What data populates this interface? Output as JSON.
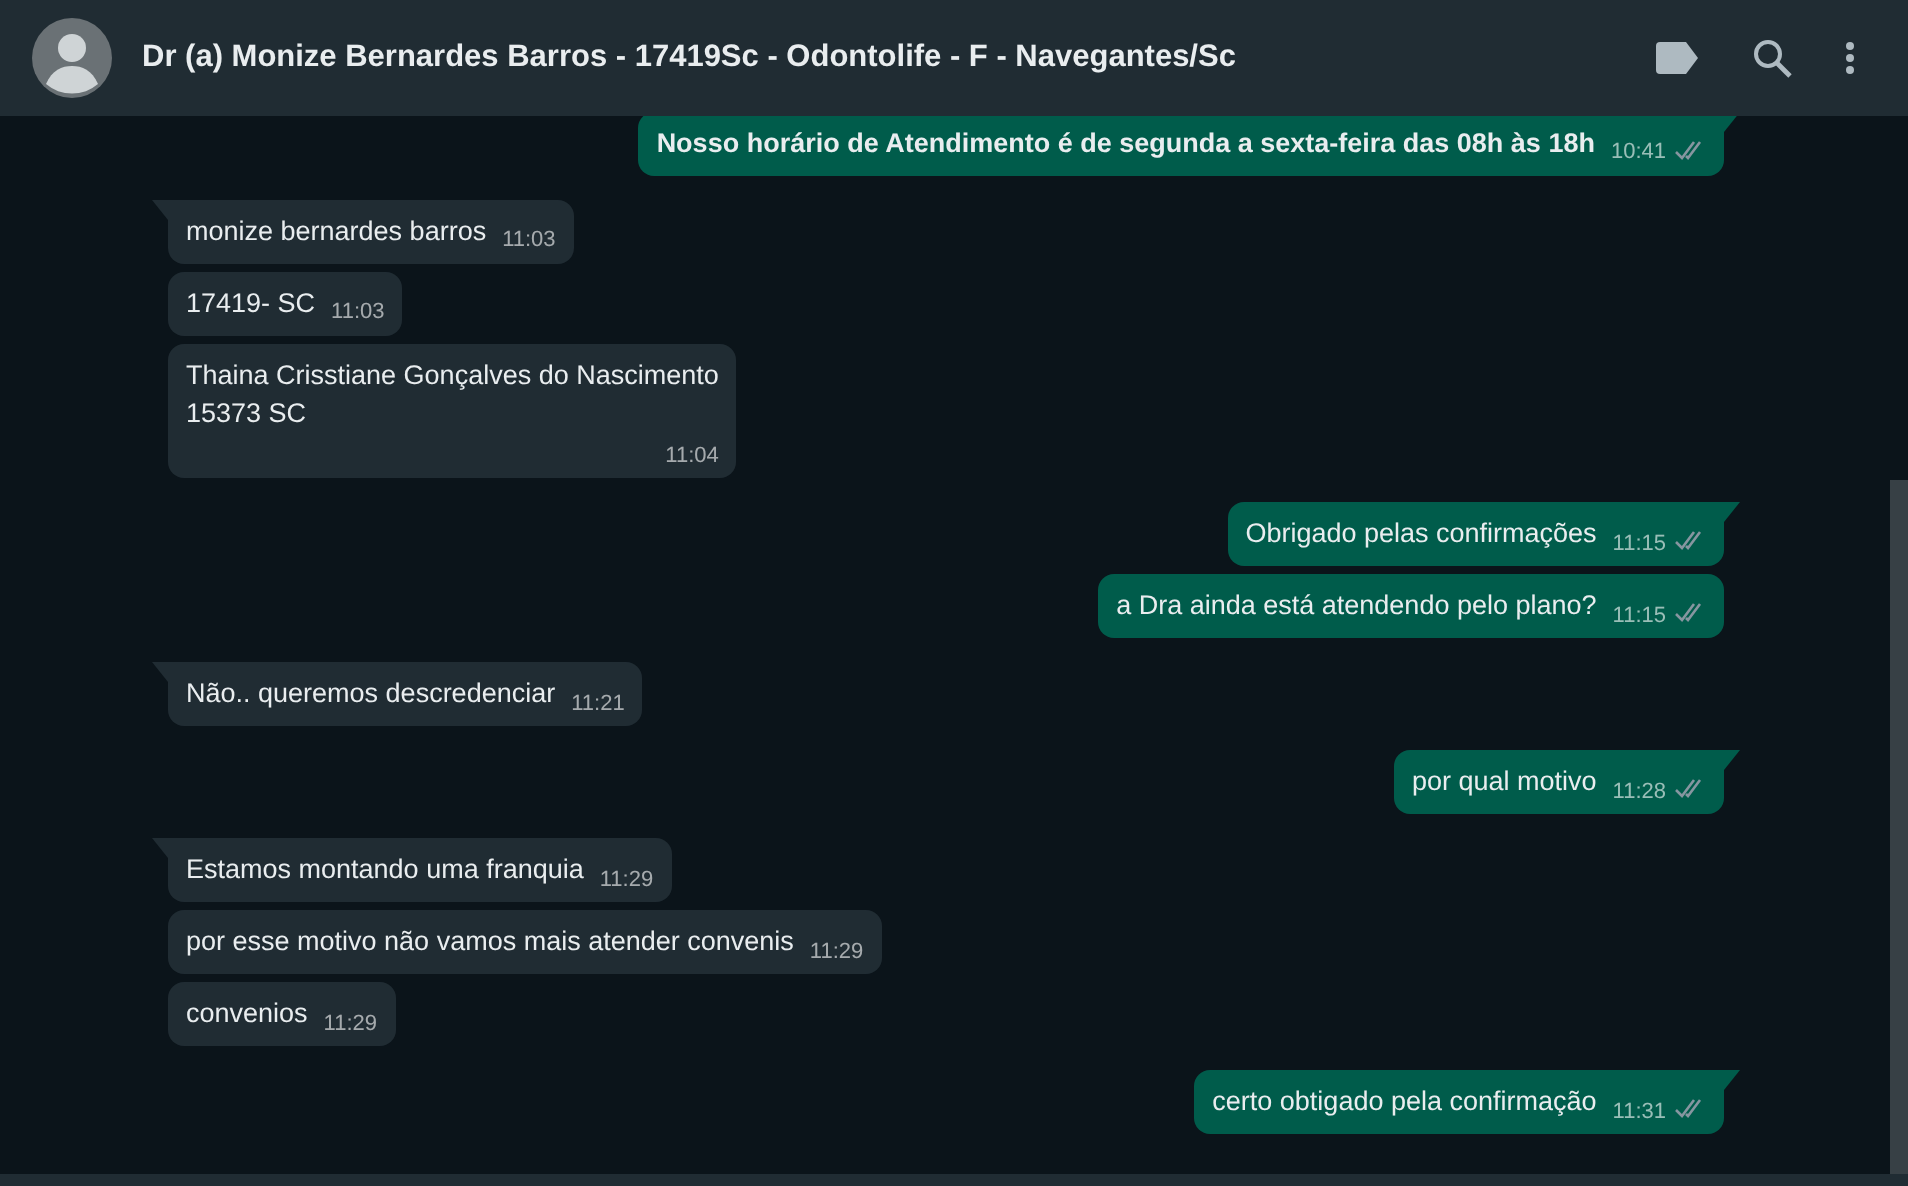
{
  "header": {
    "title": "Dr (a) Monize Bernardes Barros - 17419Sc - Odontolife - F - Navegantes/Sc"
  },
  "groups": [
    {
      "kind": "outgoing",
      "messages": [
        {
          "text": "Nosso horário de Atendimento é de segunda a sexta-feira das 08h às 18h",
          "time": "10:41",
          "bold": true
        }
      ]
    },
    {
      "kind": "incoming",
      "messages": [
        {
          "text": "monize bernardes barros",
          "time": "11:03"
        },
        {
          "text": "17419- SC",
          "time": "11:03"
        },
        {
          "text": "Thaina Crisstiane Gonçalves do Nascimento\n15373 SC",
          "time": "11:04"
        }
      ]
    },
    {
      "kind": "outgoing",
      "messages": [
        {
          "text": "Obrigado pelas confirmações",
          "time": "11:15"
        },
        {
          "text": "a Dra ainda está atendendo pelo plano?",
          "time": "11:15"
        }
      ]
    },
    {
      "kind": "incoming",
      "messages": [
        {
          "text": "Não.. queremos descredenciar",
          "time": "11:21"
        }
      ]
    },
    {
      "kind": "outgoing",
      "messages": [
        {
          "text": "por qual motivo",
          "time": "11:28"
        }
      ]
    },
    {
      "kind": "incoming",
      "messages": [
        {
          "text": "Estamos montando uma franquia",
          "time": "11:29"
        },
        {
          "text": "por esse motivo não vamos mais atender convenis",
          "time": "11:29"
        },
        {
          "text": "convenios",
          "time": "11:29"
        }
      ]
    },
    {
      "kind": "outgoing",
      "messages": [
        {
          "text": "certo obtigado pela confirmação",
          "time": "11:31"
        }
      ]
    }
  ]
}
